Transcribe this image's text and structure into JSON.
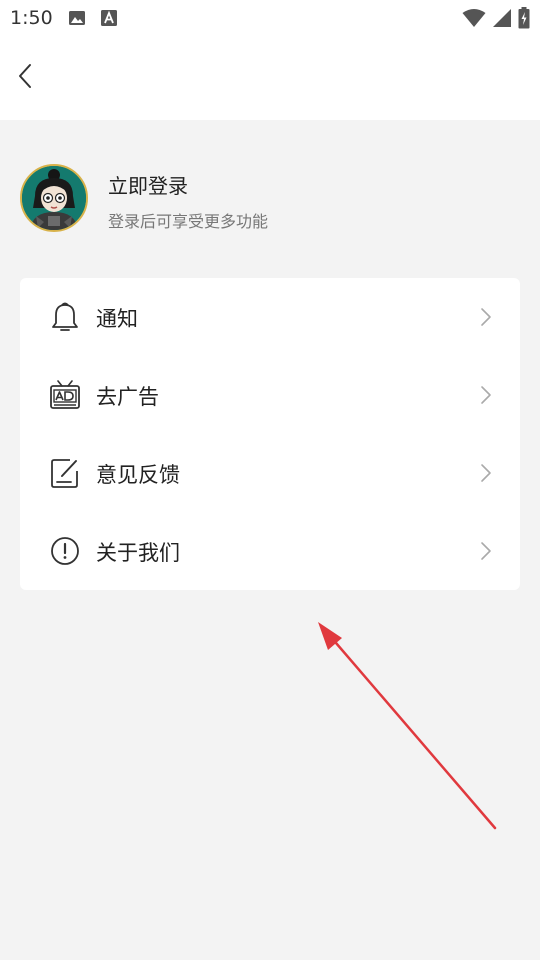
{
  "status_bar": {
    "time": "1:50",
    "left_icons": [
      "image-icon",
      "font-icon"
    ],
    "right_icons": [
      "wifi-icon",
      "cell-signal-icon",
      "battery-icon"
    ]
  },
  "nav": {
    "back_icon": "chevron-left-icon"
  },
  "profile": {
    "title": "立即登录",
    "subtitle": "登录后可享受更多功能"
  },
  "menu": {
    "items": [
      {
        "label": "通知",
        "icon": "bell-icon"
      },
      {
        "label": "去广告",
        "icon": "ad-tv-icon"
      },
      {
        "label": "意见反馈",
        "icon": "feedback-edit-icon"
      },
      {
        "label": "关于我们",
        "icon": "info-exclamation-icon"
      }
    ]
  },
  "colors": {
    "page_background": "#f3f3f3",
    "card_background": "#ffffff",
    "text_primary": "#222222",
    "text_secondary": "#777777",
    "annotation_arrow": "#e0393e",
    "avatar_border": "#d8b24a",
    "avatar_background": "#147a6e"
  }
}
